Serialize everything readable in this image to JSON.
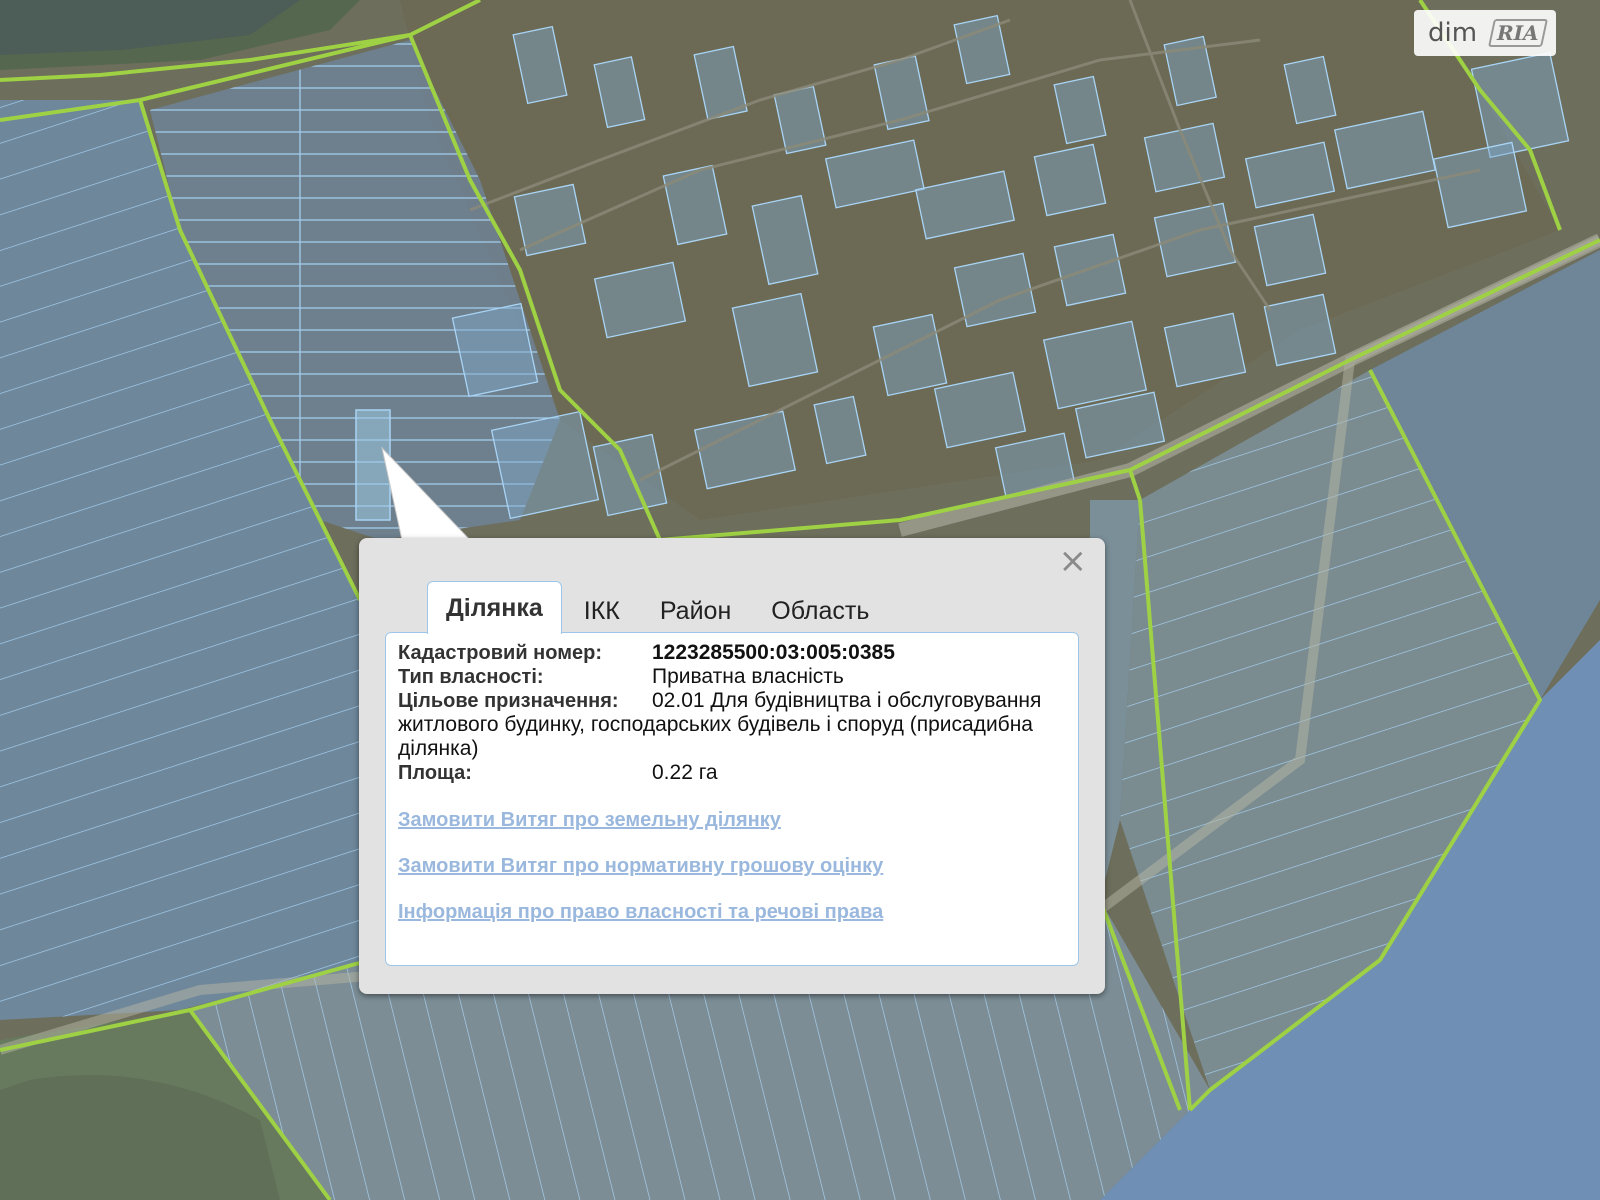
{
  "watermark": {
    "text": "dim",
    "logo_text": "RIA"
  },
  "popup": {
    "tabs": [
      "Ділянка",
      "ІКК",
      "Район",
      "Область"
    ],
    "active_tab": "Ділянка",
    "close_symbol": "×",
    "fields": {
      "cadastral_label": "Кадастровий номер:",
      "cadastral_value": "1223285500:03:005:0385",
      "ownership_label": "Тип власності:",
      "ownership_value": "Приватна власність",
      "purpose_label": "Цільове призначення:",
      "purpose_value": "02.01 Для будівництва і обслуговування житлового будинку, господарських будівель і споруд (присадибна ділянка)",
      "area_label": "Площа:",
      "area_value": "0.22 га"
    },
    "links": [
      "Замовити Витяг про земельну ділянку",
      "Замовити Витяг про нормативну грошову оцінку",
      "Інформація про право власності та речові права"
    ]
  },
  "colors": {
    "parcel_outline": "#a9d4f5",
    "parcel_fill": "#7fa8cc",
    "boundary_line": "#9ed144",
    "terrain": "#6d705c",
    "field": "#7a8b8f",
    "water": "#6f8fb4",
    "link": "#9ab8dd",
    "tab_border": "#9ec6ea"
  }
}
